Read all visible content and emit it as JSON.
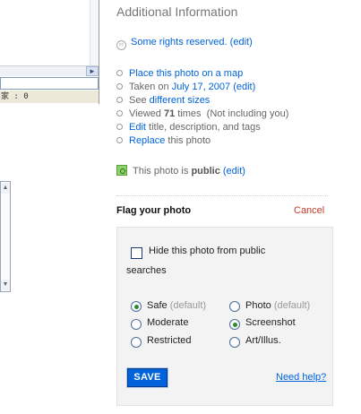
{
  "left_window": {
    "counter_text": "家 : 0",
    "scroll_arrow": "►",
    "textarea_up_arrow": "▲",
    "textarea_down_arrow": "▼"
  },
  "info": {
    "title": "Additional Information",
    "license": {
      "link": "Some rights reserved.",
      "edit": "(edit)"
    },
    "items": {
      "map_link": "Place this photo on a map",
      "taken_prefix": "Taken on",
      "taken_date": "July 17, 2007",
      "taken_edit": "(edit)",
      "see_prefix": "See",
      "sizes_link": "different sizes",
      "viewed_prefix": "Viewed",
      "viewed_count": "71",
      "viewed_suffix": "times",
      "viewed_note": "(Not including you)",
      "edit_link": "Edit",
      "edit_suffix": "title, description, and tags",
      "replace_link": "Replace",
      "replace_suffix": "this photo"
    },
    "privacy": {
      "prefix": "This photo is",
      "value": "public",
      "edit": "(edit)"
    }
  },
  "flag": {
    "title": "Flag your photo",
    "cancel": "Cancel",
    "hide_label_line1": "Hide this photo from public",
    "hide_label_line2": "searches",
    "hide_checked": false,
    "safety": [
      {
        "label": "Safe",
        "default": "(default)",
        "selected": true
      },
      {
        "label": "Moderate",
        "default": "",
        "selected": false
      },
      {
        "label": "Restricted",
        "default": "",
        "selected": false
      }
    ],
    "content_type": [
      {
        "label": "Photo",
        "default": "(default)",
        "selected": false
      },
      {
        "label": "Screenshot",
        "default": "",
        "selected": true
      },
      {
        "label": "Art/Illus.",
        "default": "",
        "selected": false
      }
    ],
    "save_label": "SAVE",
    "help_label": "Need help?"
  },
  "colors": {
    "link": "#0063dc",
    "cancel": "#c0392b",
    "save_bg": "#0063dc",
    "radio_selected": "#2e8b2e"
  }
}
